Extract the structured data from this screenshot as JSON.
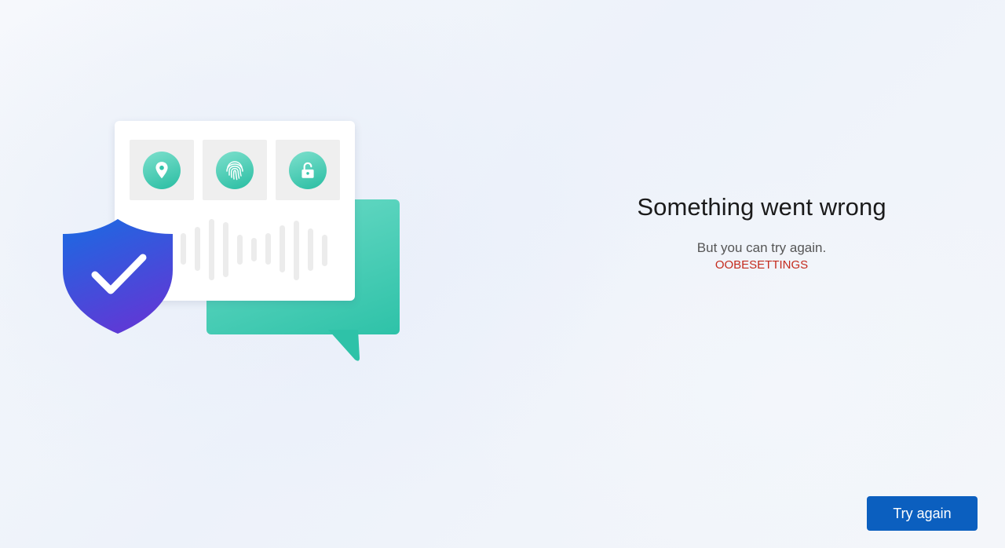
{
  "main": {
    "title": "Something went wrong",
    "subtitle": "But you can try again.",
    "error_code": "OOBESETTINGS"
  },
  "actions": {
    "try_again_label": "Try again"
  },
  "illustration": {
    "icons": [
      "location-pin-icon",
      "fingerprint-icon",
      "unlock-icon",
      "checkmark-icon"
    ],
    "colors": {
      "teal": "#2ec2a8",
      "shield_blue": "#1f63e0",
      "shield_purple": "#5a3fd8"
    }
  },
  "colors": {
    "accent": "#0b5fbf",
    "error": "#c42b1c"
  }
}
